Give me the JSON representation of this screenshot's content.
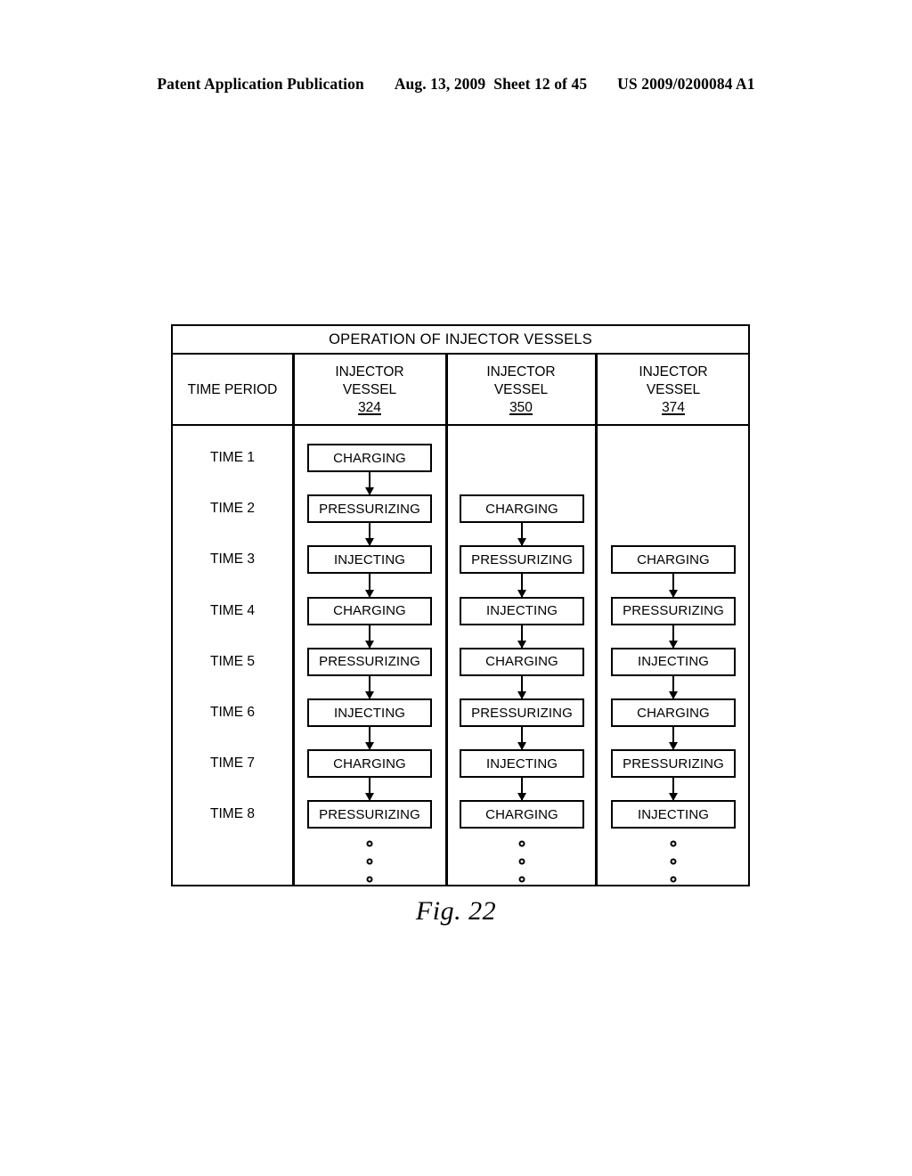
{
  "header": {
    "publication": "Patent Application Publication",
    "date": "Aug. 13, 2009",
    "sheet": "Sheet 12 of 45",
    "patent_number": "US 2009/0200084 A1"
  },
  "figure": {
    "caption": "Fig. 22",
    "table_title": "OPERATION OF INJECTOR VESSELS",
    "columns": [
      {
        "label": "TIME PERIOD",
        "line1": "TIME PERIOD",
        "line2": "",
        "number": ""
      },
      {
        "label": "INJECTOR VESSEL 324",
        "line1": "INJECTOR",
        "line2": "VESSEL",
        "number": "324"
      },
      {
        "label": "INJECTOR VESSEL 350",
        "line1": "INJECTOR",
        "line2": "VESSEL",
        "number": "350"
      },
      {
        "label": "INJECTOR VESSEL 374",
        "line1": "INJECTOR",
        "line2": "VESSEL",
        "number": "374"
      }
    ],
    "rows": [
      {
        "time": "TIME 1",
        "vessel324": "CHARGING",
        "vessel350": "",
        "vessel374": ""
      },
      {
        "time": "TIME 2",
        "vessel324": "PRESSURIZING",
        "vessel350": "CHARGING",
        "vessel374": ""
      },
      {
        "time": "TIME 3",
        "vessel324": "INJECTING",
        "vessel350": "PRESSURIZING",
        "vessel374": "CHARGING"
      },
      {
        "time": "TIME 4",
        "vessel324": "CHARGING",
        "vessel350": "INJECTING",
        "vessel374": "PRESSURIZING"
      },
      {
        "time": "TIME 5",
        "vessel324": "PRESSURIZING",
        "vessel350": "CHARGING",
        "vessel374": "INJECTING"
      },
      {
        "time": "TIME 6",
        "vessel324": "INJECTING",
        "vessel350": "PRESSURIZING",
        "vessel374": "CHARGING"
      },
      {
        "time": "TIME 7",
        "vessel324": "CHARGING",
        "vessel350": "INJECTING",
        "vessel374": "PRESSURIZING"
      },
      {
        "time": "TIME 8",
        "vessel324": "PRESSURIZING",
        "vessel350": "CHARGING",
        "vessel374": "INJECTING"
      }
    ],
    "continuation_marker": "vertical-ellipsis"
  },
  "colors": {
    "ink": "#000000",
    "paper": "#ffffff"
  }
}
